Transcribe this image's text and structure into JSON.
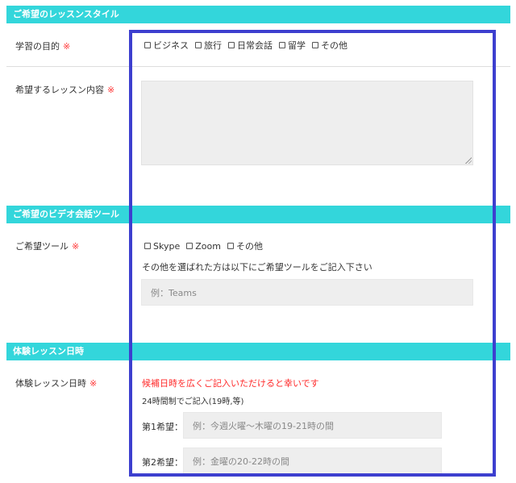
{
  "sections": {
    "lesson_style": {
      "header": "ご希望のレッスンスタイル"
    },
    "video_tool": {
      "header": "ご希望のビデオ会話ツール"
    },
    "trial_date": {
      "header": "体験レッスン日時"
    }
  },
  "required_mark": "※",
  "purpose": {
    "label": "学習の目的",
    "options": [
      "ビジネス",
      "旅行",
      "日常会話",
      "留学",
      "その他"
    ]
  },
  "lesson_content": {
    "label": "希望するレッスン内容",
    "value": ""
  },
  "tool": {
    "label": "ご希望ツール",
    "options": [
      "Skype",
      "Zoom",
      "その他"
    ],
    "hint": "その他を選ばれた方は以下にご希望ツールをご記入下さい",
    "placeholder": "例：Teams"
  },
  "trial": {
    "label": "体験レッスン日時",
    "notice": "候補日時を広くご記入いただけると幸いです",
    "format_hint": "24時間制でご記入(19時,等)",
    "first_label": "第1希望：",
    "first_placeholder": "例：今週火曜〜木曜の19-21時の間",
    "second_label": "第2希望：",
    "second_placeholder": "例：金曜の20-22時の間"
  },
  "colors": {
    "section_header_bg": "#33d6db",
    "required": "#ff3333",
    "highlight_border": "#3d3fcf",
    "field_bg": "#eeeeee"
  }
}
